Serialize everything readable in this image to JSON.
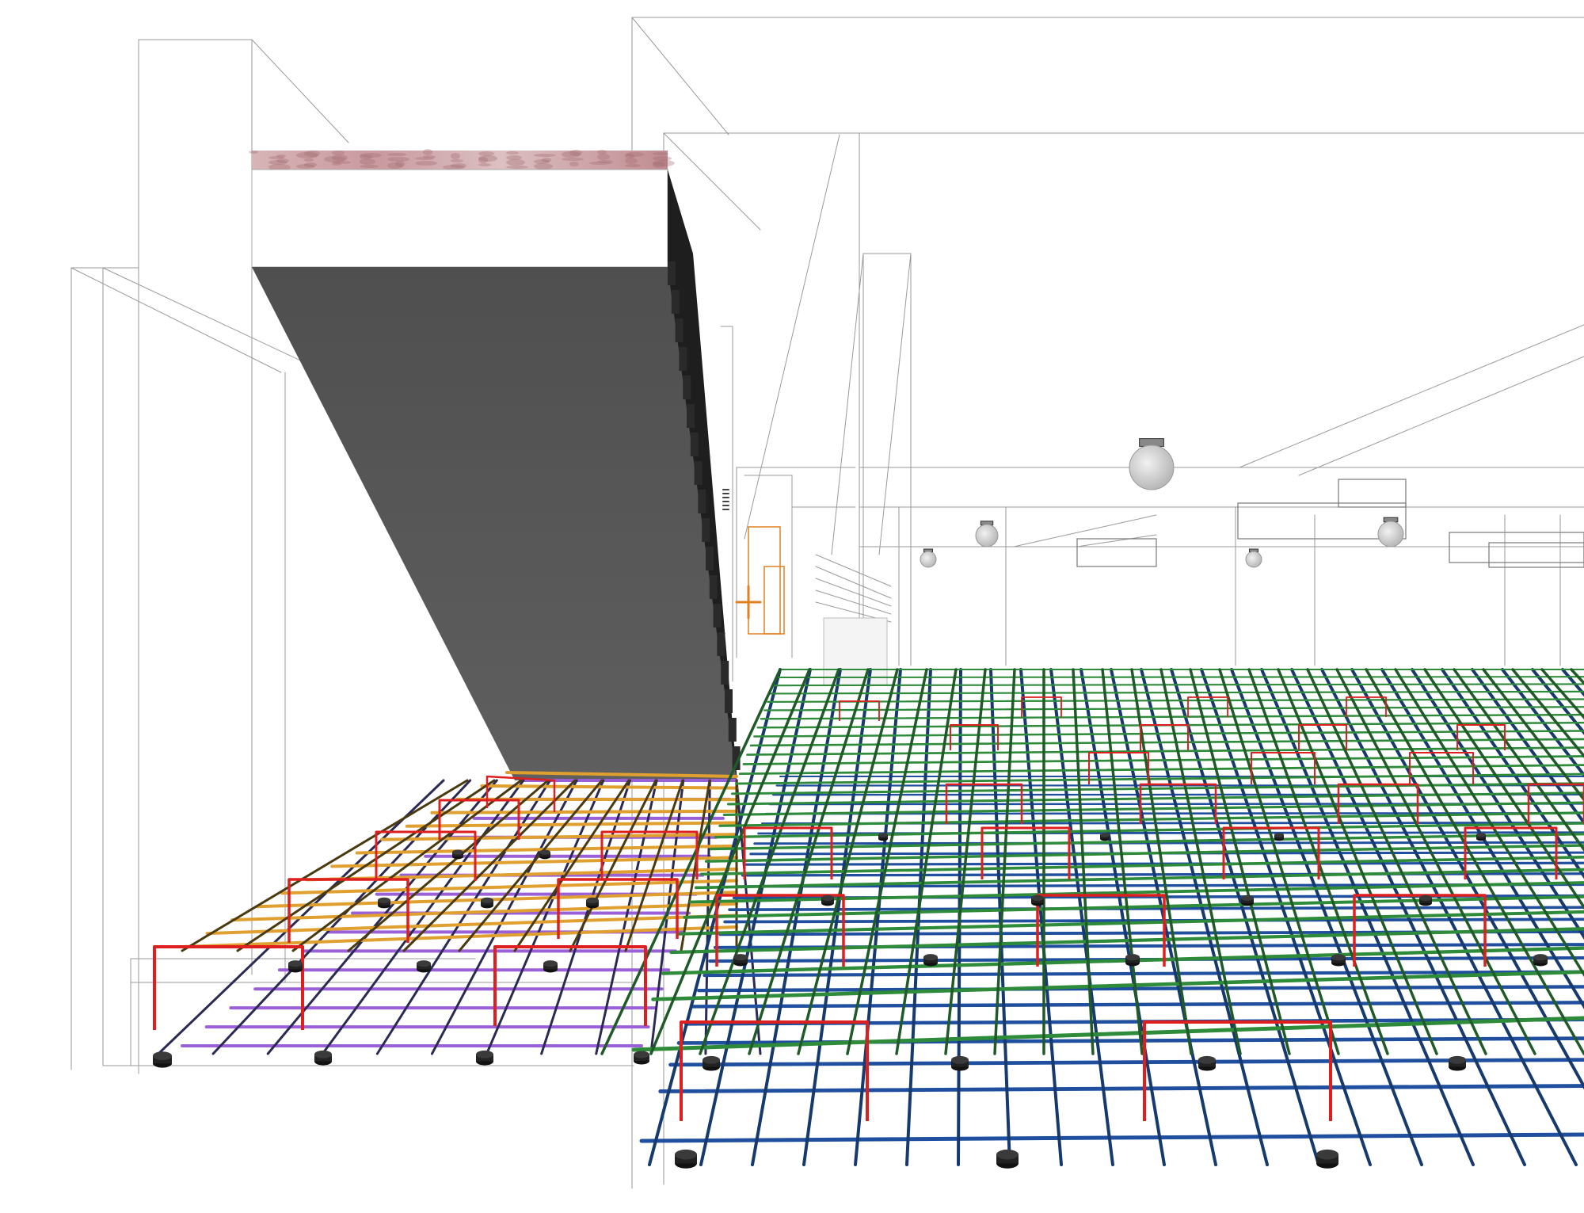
{
  "scene": {
    "subject": "rebar-layout-3d",
    "colors": {
      "background": "#ffffff",
      "wireframe": "#9a9a9a",
      "beam_dark": "#6a6a6a",
      "beam_light": "#5a5a5a",
      "beam_side": "#1e1e1e",
      "marble_base": "#d8b8b8",
      "marble_vein": "#a06a70",
      "rebar_top_green": "#2e8b3a",
      "rebar_bottom_blue": "#1f4f9e",
      "rebar_top_orange": "#e0a030",
      "rebar_bottom_purple": "#9a60d8",
      "stirrup_red": "#dd1f1f",
      "spacer_dark": "#1a1a1a",
      "orange_frame": "#e08020"
    },
    "icons": [
      "ceiling-lamp-icon",
      "rebar-chair-icon"
    ]
  }
}
